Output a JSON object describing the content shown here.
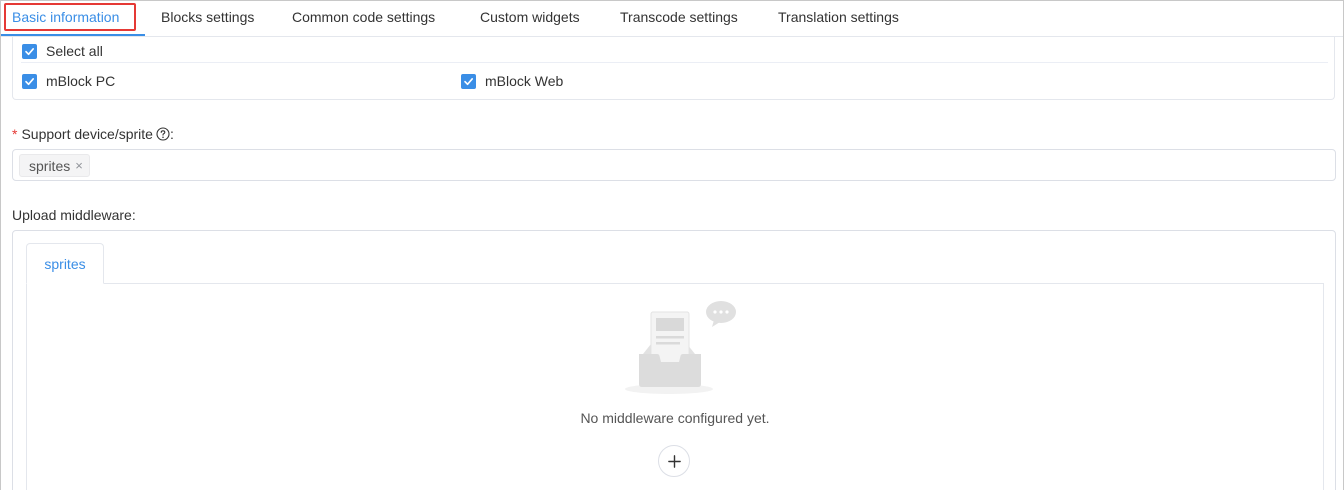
{
  "tabs": [
    {
      "label": "Basic information",
      "active": true
    },
    {
      "label": "Blocks settings",
      "active": false
    },
    {
      "label": "Common code settings",
      "active": false
    },
    {
      "label": "Custom widgets",
      "active": false
    },
    {
      "label": "Transcode settings",
      "active": false
    },
    {
      "label": "Translation settings",
      "active": false
    }
  ],
  "platforms": {
    "select_all": {
      "label": "Select all",
      "checked": true
    },
    "options": [
      {
        "label": "mBlock PC",
        "checked": true
      },
      {
        "label": "mBlock Web",
        "checked": true
      }
    ]
  },
  "support_device": {
    "required_mark": "*",
    "label": "Support device/sprite",
    "colon": ":",
    "help_icon": "question-circle-icon",
    "tags": [
      {
        "label": "sprites",
        "close": "×"
      }
    ]
  },
  "upload_middleware": {
    "label": "Upload middleware:",
    "tabs": [
      {
        "label": "sprites",
        "active": true
      }
    ],
    "empty_text": "No middleware configured yet.",
    "add_icon": "plus-icon"
  },
  "colors": {
    "accent": "#3a8ee6",
    "highlight": "#e53935",
    "border": "#dcdfe6"
  }
}
